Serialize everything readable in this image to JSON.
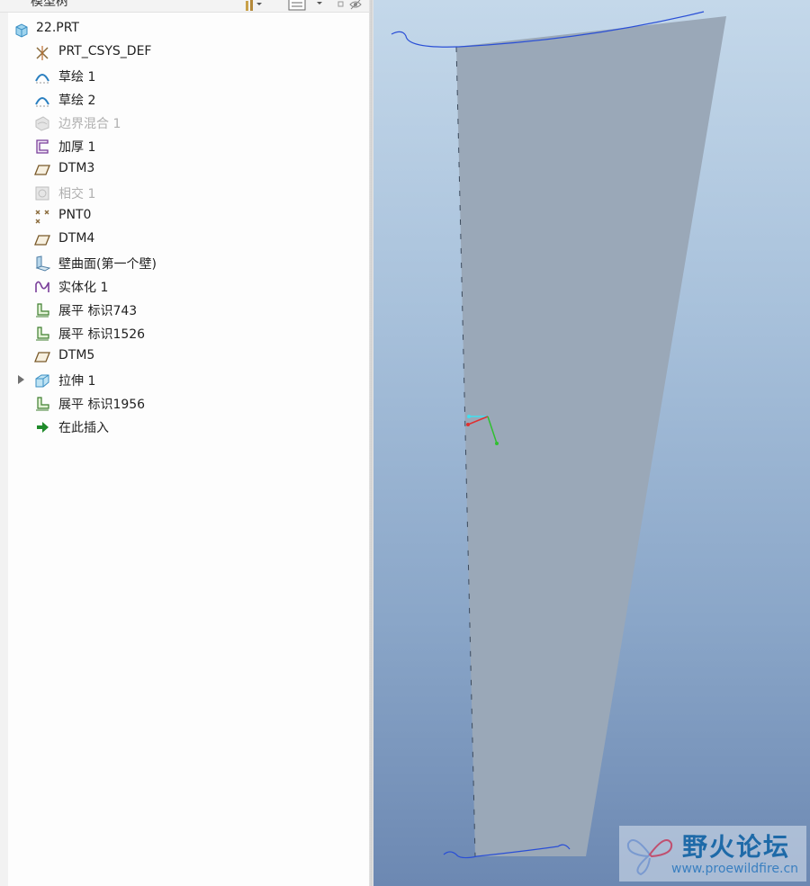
{
  "panel": {
    "title": "模型树"
  },
  "tree": {
    "root": {
      "label": "22.PRT",
      "icon": "part-icon"
    },
    "items": [
      {
        "label": "PRT_CSYS_DEF",
        "icon": "csys-icon",
        "dim": false
      },
      {
        "label": "草绘 1",
        "icon": "sketch-icon",
        "dim": false
      },
      {
        "label": "草绘 2",
        "icon": "sketch-icon",
        "dim": false
      },
      {
        "label": "边界混合 1",
        "icon": "boundary-blend-icon",
        "dim": true
      },
      {
        "label": "加厚 1",
        "icon": "thicken-icon",
        "dim": false
      },
      {
        "label": "DTM3",
        "icon": "datum-plane-icon",
        "dim": false
      },
      {
        "label": "相交 1",
        "icon": "intersect-icon",
        "dim": true
      },
      {
        "label": "PNT0",
        "icon": "datum-point-icon",
        "dim": false
      },
      {
        "label": "DTM4",
        "icon": "datum-plane-icon",
        "dim": false
      },
      {
        "label": "壁曲面(第一个壁)",
        "icon": "wall-surface-icon",
        "dim": false
      },
      {
        "label": "实体化 1",
        "icon": "solidify-icon",
        "dim": false
      },
      {
        "label": "展平 标识743",
        "icon": "flatten-icon",
        "dim": false
      },
      {
        "label": "展平 标识1526",
        "icon": "flatten-icon",
        "dim": false
      },
      {
        "label": "DTM5",
        "icon": "datum-plane-icon",
        "dim": false
      },
      {
        "label": "拉伸 1",
        "icon": "extrude-icon",
        "dim": false,
        "expandable": true
      },
      {
        "label": "展平 标识1956",
        "icon": "flatten-icon",
        "dim": false
      },
      {
        "label": "在此插入",
        "icon": "insert-here-arrow-icon",
        "dim": false
      }
    ]
  },
  "watermark": {
    "title": "野火论坛",
    "url": "www.proewildfire.cn"
  },
  "colors": {
    "surface": "#9aa8b8",
    "curve": "#2a4fd6",
    "background_top": "#c4d8ea",
    "background_bottom": "#6c88b2"
  }
}
